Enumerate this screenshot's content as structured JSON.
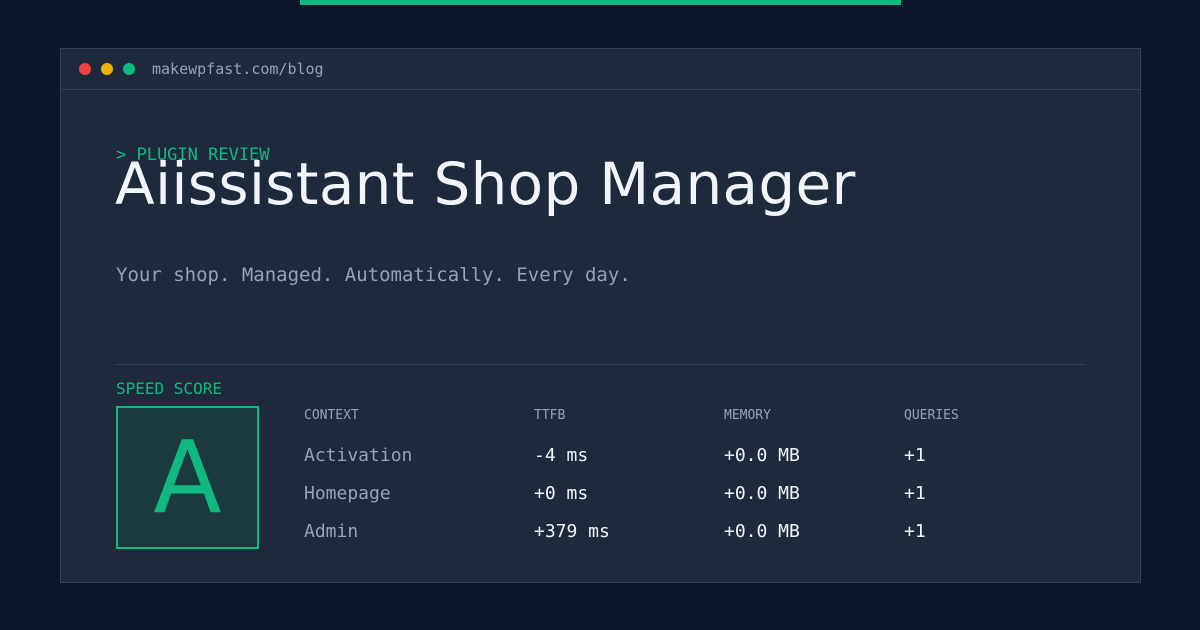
{
  "window": {
    "url": "makewpfast.com/blog"
  },
  "header": {
    "kicker": "> PLUGIN REVIEW",
    "title": "Aiissistant Shop Manager",
    "tagline": "Your shop. Managed. Automatically. Every day."
  },
  "score": {
    "label": "SPEED SCORE",
    "grade": "A"
  },
  "table": {
    "headers": [
      "CONTEXT",
      "TTFB",
      "MEMORY",
      "QUERIES"
    ],
    "rows": [
      [
        "Activation",
        "-4 ms",
        "+0.0 MB",
        "+1"
      ],
      [
        "Homepage",
        "+0 ms",
        "+0.0 MB",
        "+1"
      ],
      [
        "Admin",
        "+379 ms",
        "+0.0 MB",
        "+1"
      ]
    ]
  },
  "colors": {
    "background": "#0f172a",
    "panel": "#1e293b",
    "accent": "#10b981",
    "muted_text": "#94a3b8",
    "text": "#f1f5f9",
    "traffic_red": "#ef4444",
    "traffic_yellow": "#eab308",
    "traffic_green": "#10b981"
  }
}
